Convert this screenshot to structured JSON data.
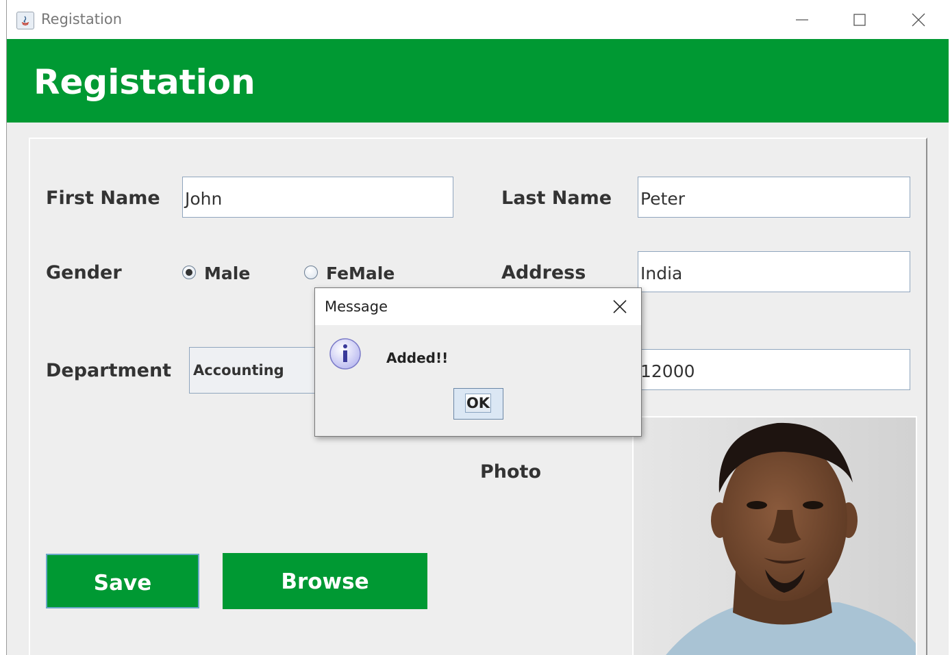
{
  "window": {
    "title": "Registation",
    "controls": [
      "minimize-icon",
      "maximize-icon",
      "close-icon"
    ]
  },
  "header": {
    "title": "Registation",
    "color": "#009933"
  },
  "form": {
    "first_name_label": "First Name",
    "first_name_value": "John",
    "last_name_label": "Last Name",
    "last_name_value": "Peter",
    "gender_label": "Gender",
    "gender_options": [
      {
        "label": "Male",
        "selected": true
      },
      {
        "label": "FeMale",
        "selected": false
      }
    ],
    "address_label": "Address",
    "address_value": "India",
    "department_label": "Department",
    "department_value": "Accounting",
    "salary_value": "12000",
    "photo_label": "Photo"
  },
  "buttons": {
    "save": "Save",
    "browse": "Browse"
  },
  "dialog": {
    "title": "Message",
    "message": "Added!!",
    "ok": "OK",
    "icon": "info-icon"
  }
}
